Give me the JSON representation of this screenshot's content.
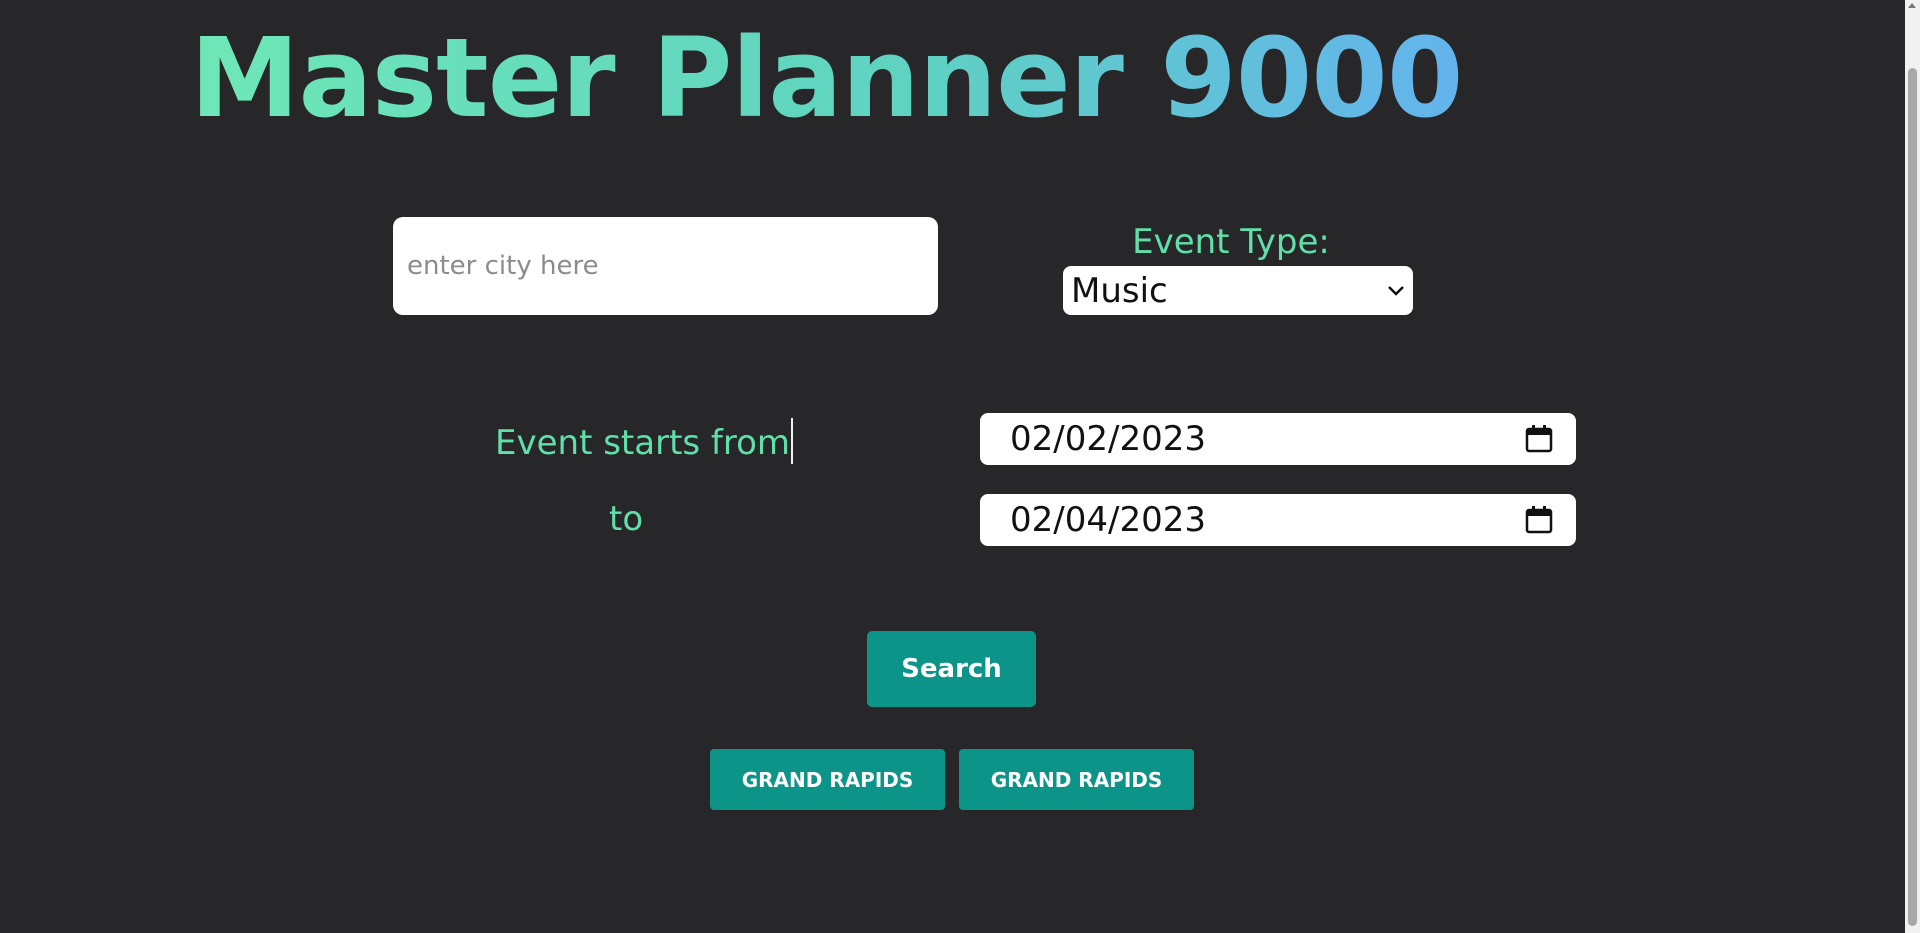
{
  "header": {
    "title": "Master Planner 9000"
  },
  "search_form": {
    "city_placeholder": "enter city here",
    "city_value": "",
    "event_type_label": "Event Type:",
    "event_type_selected": "Music",
    "starts_from_label": "Event starts from",
    "to_label": "to",
    "start_date": "02/02/2023",
    "end_date": "02/04/2023",
    "search_label": "Search"
  },
  "recent_searches": [
    {
      "label": "GRAND RAPIDS"
    },
    {
      "label": "GRAND RAPIDS"
    }
  ],
  "icons": {
    "select_arrow": "chevron-down-icon",
    "date_picker": "calendar-icon"
  },
  "colors": {
    "background": "#27272a",
    "accent_green": "#5fe0a8",
    "button_teal": "#0d9488",
    "title_gradient_start": "#6ee7b7",
    "title_gradient_end": "#63b3ed"
  }
}
